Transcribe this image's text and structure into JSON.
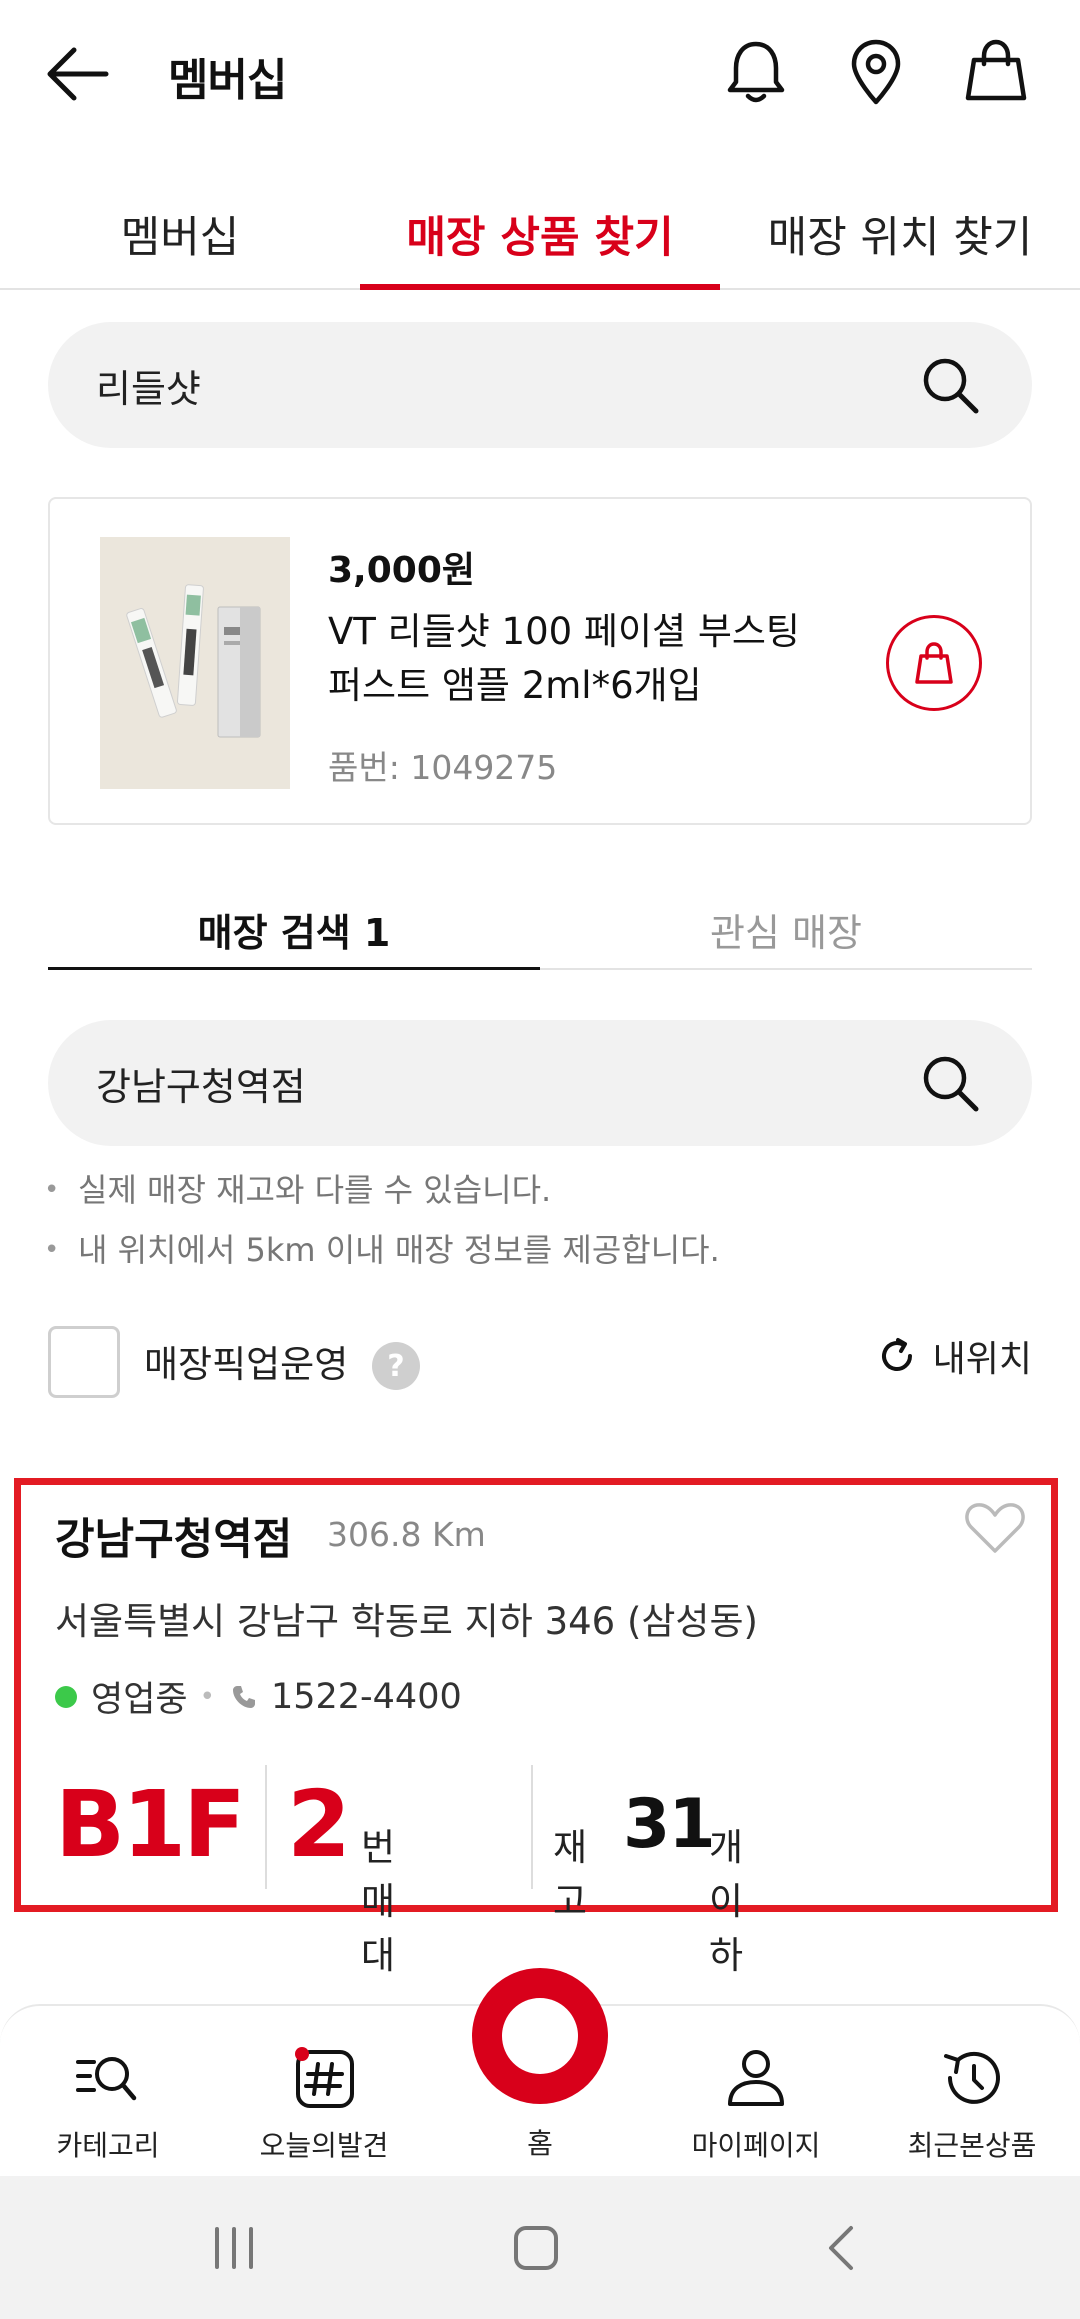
{
  "header": {
    "title": "멤버십"
  },
  "tabs": [
    {
      "label": "멤버십",
      "active": false
    },
    {
      "label": "매장 상품 찾기",
      "active": true
    },
    {
      "label": "매장 위치 찾기",
      "active": false
    }
  ],
  "product_search": {
    "value": "리들샷"
  },
  "product": {
    "price": "3,000원",
    "name": "VT 리들샷 100 페이셜 부스팅 퍼스트 앰플 2ml*6개입",
    "code": "품번: 1049275"
  },
  "sub_tabs": [
    {
      "label": "매장 검색 1",
      "active": true
    },
    {
      "label": "관심 매장",
      "active": false
    }
  ],
  "store_search": {
    "value": "강남구청역점"
  },
  "notes": [
    "실제 매장 재고와 다를 수 있습니다.",
    "내 위치에서 5km 이내 매장 정보를 제공합니다."
  ],
  "filter": {
    "pickup_label": "매장픽업운영",
    "help": "?",
    "my_location": "내위치"
  },
  "store": {
    "name": "강남구청역점",
    "distance": "306.8 Km",
    "address": "서울특별시 강남구 학동로 지하 346 (삼성동)",
    "status": "영업중",
    "phone": "1522-4400",
    "floor": "B1F",
    "shelf_number": "2",
    "shelf_label": "번 매대",
    "stock_prefix": "재고",
    "stock_count": "31",
    "stock_suffix": "개 이하"
  },
  "bottom_nav": [
    {
      "label": "카테고리",
      "icon": "category-search-icon"
    },
    {
      "label": "오늘의발견",
      "icon": "hashtag-icon"
    },
    {
      "label": "홈",
      "icon": "home-ring-icon"
    },
    {
      "label": "마이페이지",
      "icon": "person-icon"
    },
    {
      "label": "최근본상품",
      "icon": "history-icon"
    }
  ],
  "colors": {
    "accent": "#d8001a",
    "highlight_border": "#e31b23",
    "open_status": "#3cc94a"
  }
}
